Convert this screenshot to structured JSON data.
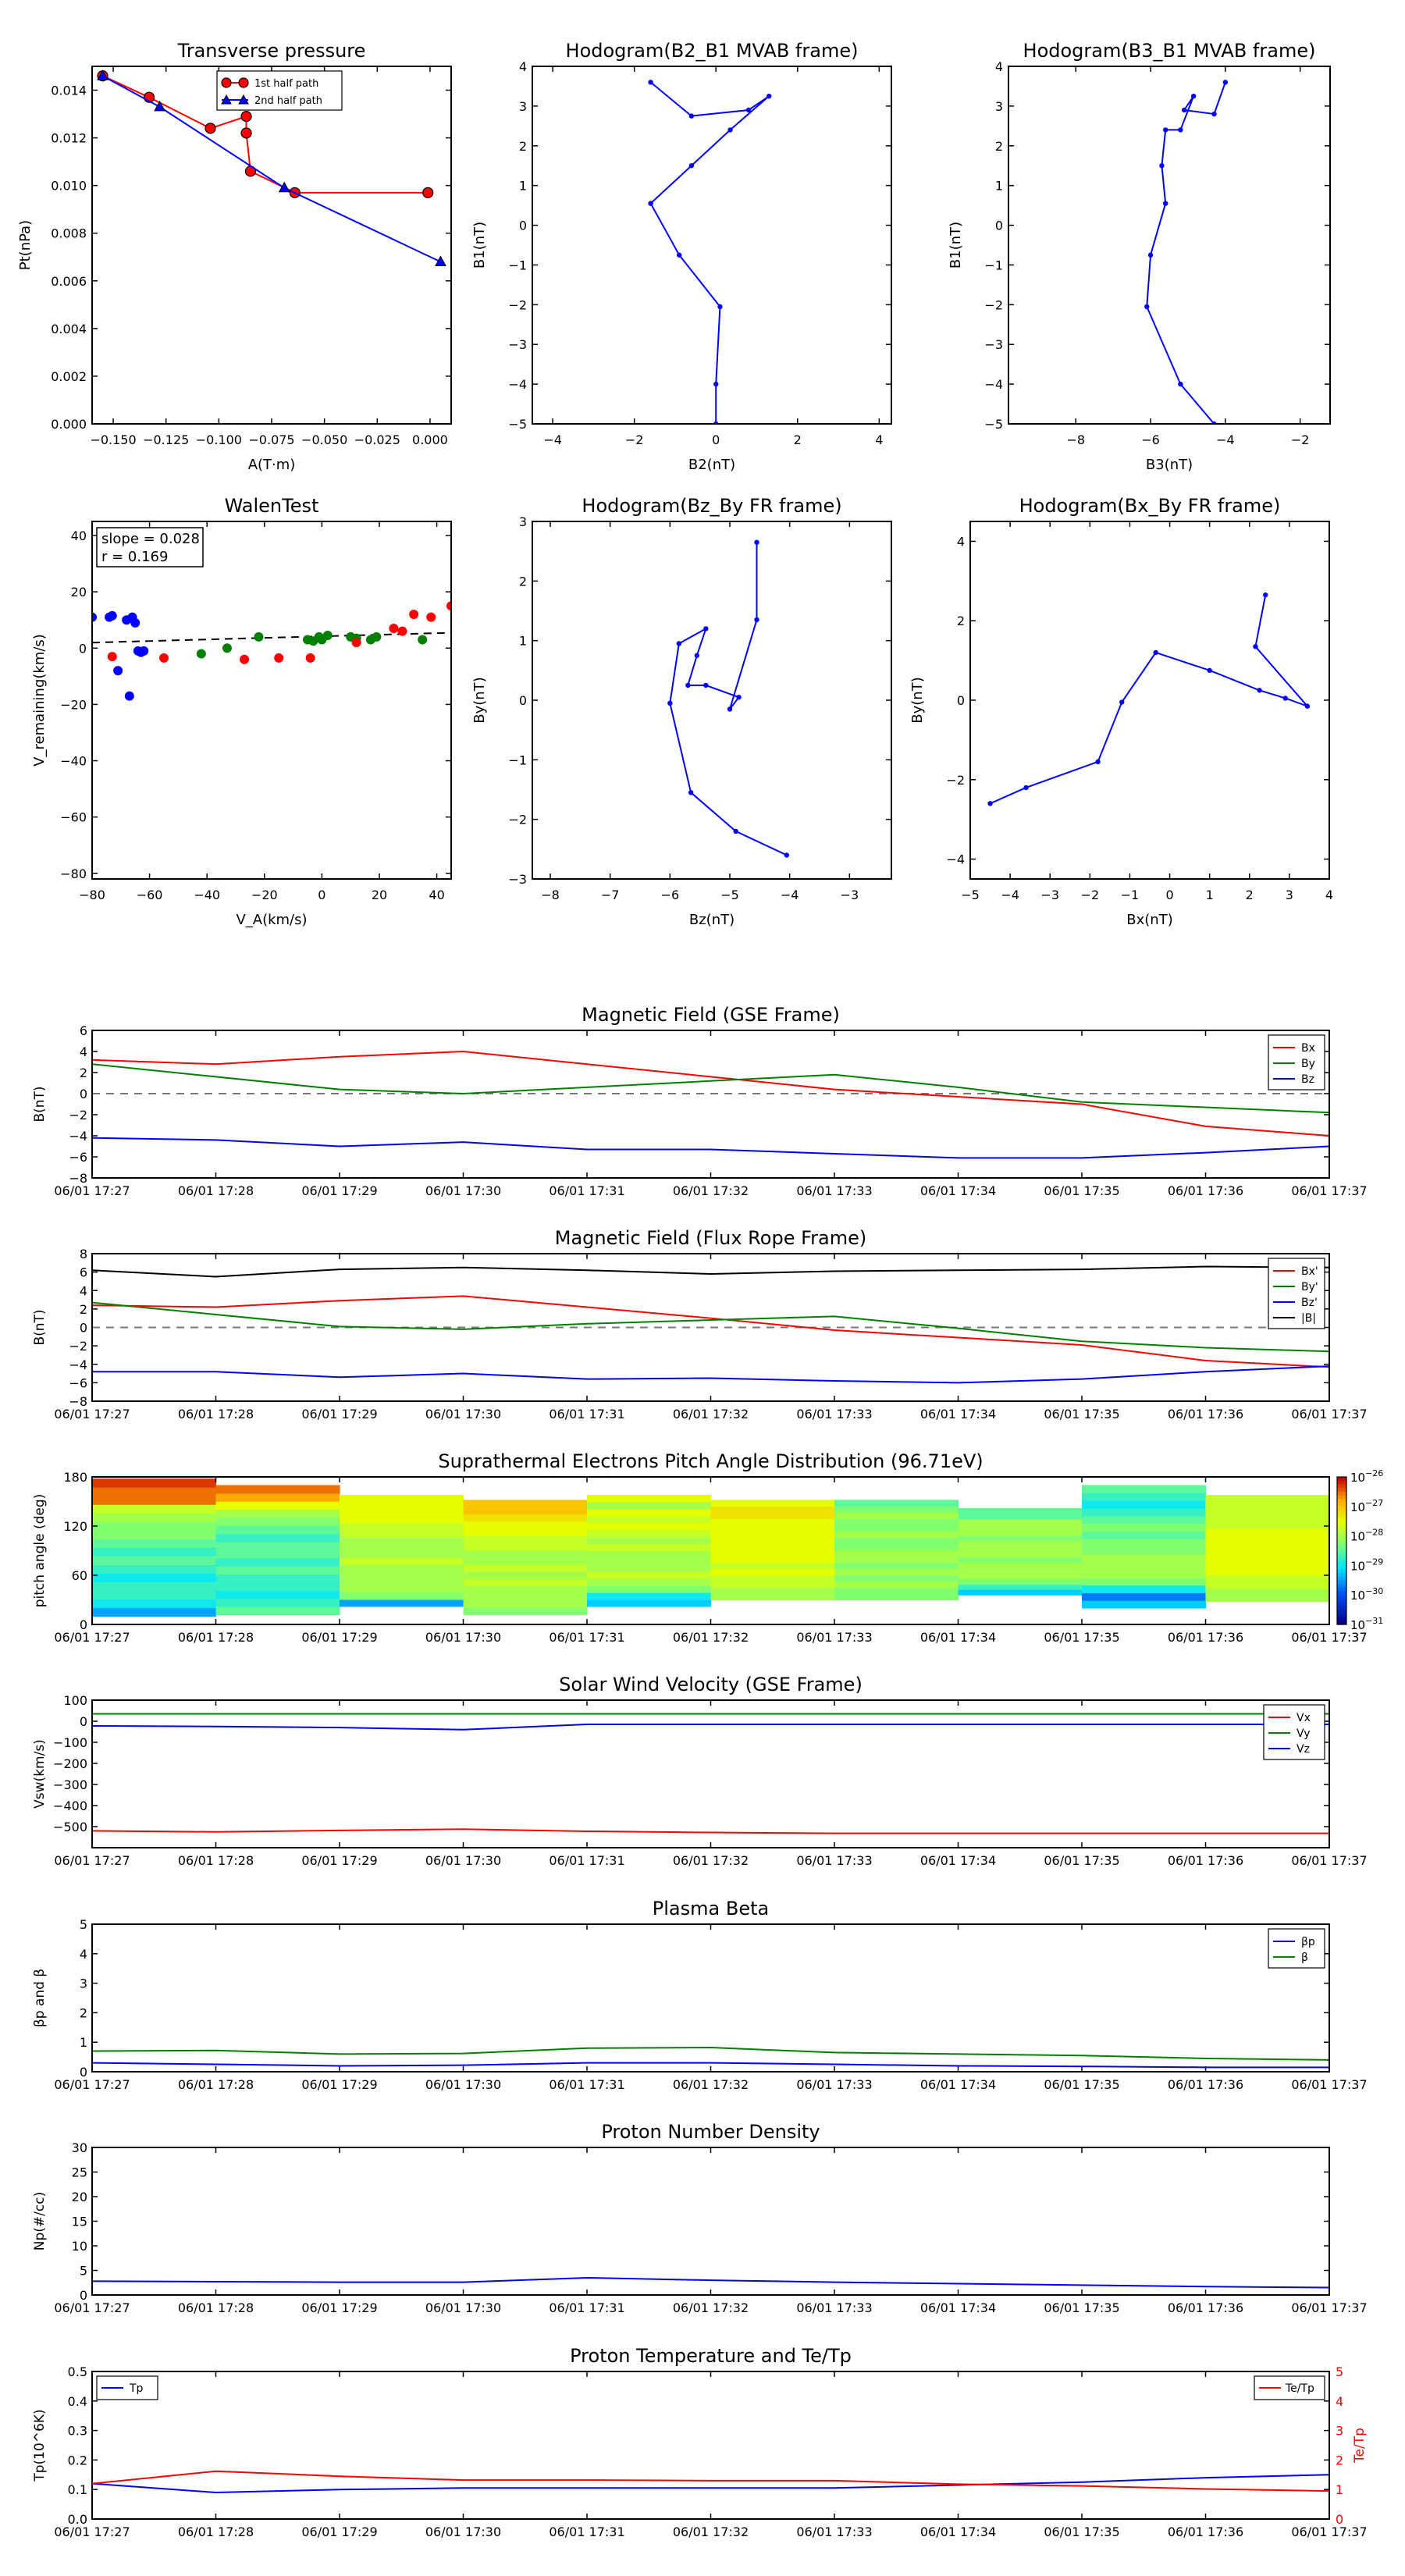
{
  "chart_data": [
    {
      "id": "tp",
      "type": "line",
      "title": "Transverse pressure",
      "xlabel": "A(T·m)",
      "ylabel": "Pt(nPa)",
      "xlim": [
        -0.16,
        0.01
      ],
      "ylim": [
        0,
        0.015
      ],
      "xticks": [
        -0.15,
        -0.125,
        -0.1,
        -0.075,
        -0.05,
        -0.025,
        0.0
      ],
      "xtick_labels": [
        "−0.150",
        "−0.125",
        "−0.100",
        "−0.075",
        "−0.050",
        "−0.025",
        "0.000"
      ],
      "yticks": [
        0,
        0.002,
        0.004,
        0.006,
        0.008,
        0.01,
        0.012,
        0.014
      ],
      "ytick_labels": [
        "0.000",
        "0.002",
        "0.004",
        "0.006",
        "0.008",
        "0.010",
        "0.012",
        "0.014"
      ],
      "legend": "upper-center",
      "series": [
        {
          "name": "1st half path",
          "color": "#ff0000",
          "marker": "circle",
          "x": [
            -0.155,
            -0.133,
            -0.104,
            -0.087,
            -0.087,
            -0.085,
            -0.064,
            -0.001
          ],
          "y": [
            0.0146,
            0.0137,
            0.0124,
            0.0129,
            0.0122,
            0.0106,
            0.0097,
            0.0097
          ]
        },
        {
          "name": "2nd half path",
          "color": "#0000ff",
          "marker": "triangle",
          "x": [
            -0.155,
            -0.128,
            -0.069,
            0.005
          ],
          "y": [
            0.0146,
            0.0133,
            0.0099,
            0.0068
          ]
        }
      ]
    },
    {
      "id": "hodo1",
      "type": "line",
      "title": "Hodogram(B2_B1 MVAB frame)",
      "xlabel": "B2(nT)",
      "ylabel": "B1(nT)",
      "xlim": [
        -4.5,
        4.3
      ],
      "ylim": [
        -5,
        4
      ],
      "xticks": [
        -4,
        -2,
        0,
        2,
        4
      ],
      "yticks": [
        -5,
        -4,
        -3,
        -2,
        -1,
        0,
        1,
        2,
        3,
        4
      ],
      "series": [
        {
          "color": "#0000ff",
          "x": [
            -1.6,
            -0.6,
            0.8,
            1.3,
            0.35,
            -0.6,
            -1.6,
            -0.9,
            0.1,
            0.0,
            0.0
          ],
          "y": [
            3.6,
            2.75,
            2.9,
            3.25,
            2.4,
            1.5,
            0.55,
            -0.75,
            -2.05,
            -4.0,
            -5.0
          ]
        }
      ]
    },
    {
      "id": "hodo2",
      "type": "line",
      "title": "Hodogram(B3_B1 MVAB frame)",
      "xlabel": "B3(nT)",
      "ylabel": "B1(nT)",
      "xlim": [
        -9.8,
        -1.2
      ],
      "ylim": [
        -5,
        4
      ],
      "xticks": [
        -8,
        -6,
        -4,
        -2
      ],
      "yticks": [
        -5,
        -4,
        -3,
        -2,
        -1,
        0,
        1,
        2,
        3,
        4
      ],
      "series": [
        {
          "color": "#0000ff",
          "x": [
            -4.0,
            -4.3,
            -5.1,
            -4.85,
            -5.2,
            -5.6,
            -5.7,
            -5.6,
            -6.0,
            -6.1,
            -5.2,
            -4.3
          ],
          "y": [
            3.6,
            2.8,
            2.9,
            3.25,
            2.4,
            2.4,
            1.5,
            0.55,
            -0.75,
            -2.05,
            -4.0,
            -5.0
          ]
        }
      ]
    },
    {
      "id": "walen",
      "type": "scatter",
      "title": "WalenTest",
      "xlabel": "V_A(km/s)",
      "ylabel": "V_remaining(km/s)",
      "xlim": [
        -80,
        45
      ],
      "ylim": [
        -82,
        45
      ],
      "xticks": [
        -80,
        -60,
        -40,
        -20,
        0,
        20,
        40
      ],
      "yticks": [
        -80,
        -60,
        -40,
        -20,
        0,
        20,
        40
      ],
      "annotation": [
        "slope = 0.028",
        "r = 0.169"
      ],
      "fit": {
        "slope": 0.028,
        "intercept": 4.2
      },
      "series": [
        {
          "color": "#0000ff",
          "x": [
            -80,
            -74,
            -73,
            -71,
            -68,
            -67,
            -66,
            -65,
            -64,
            -63,
            -62
          ],
          "y": [
            11,
            11,
            11.5,
            -8,
            10,
            -17,
            11,
            9,
            -1,
            -1.5,
            -1
          ]
        },
        {
          "color": "#008000",
          "x": [
            -42,
            -33,
            -22,
            -5,
            -3,
            -1,
            0,
            2,
            10,
            12,
            17,
            19,
            35
          ],
          "y": [
            -2,
            0,
            4,
            3,
            2.5,
            4,
            3,
            4.5,
            4,
            3.5,
            3,
            4,
            3
          ]
        },
        {
          "color": "#ff0000",
          "x": [
            -73,
            -55,
            -27,
            -15,
            -4,
            12,
            25,
            28,
            32,
            38,
            45
          ],
          "y": [
            -3,
            -3.5,
            -4,
            -3.5,
            -3.5,
            2,
            7,
            6,
            12,
            11,
            15
          ]
        }
      ]
    },
    {
      "id": "hodo3",
      "type": "line",
      "title": "Hodogram(Bz_By FR frame)",
      "xlabel": "Bz(nT)",
      "ylabel": "By(nT)",
      "xlim": [
        -8.3,
        -2.3
      ],
      "ylim": [
        -3,
        3
      ],
      "xticks": [
        -8,
        -7,
        -6,
        -5,
        -4,
        -3
      ],
      "yticks": [
        -3,
        -2,
        -1,
        0,
        1,
        2,
        3
      ],
      "series": [
        {
          "color": "#0000ff",
          "x": [
            -4.55,
            -4.55,
            -5.0,
            -4.85,
            -5.4,
            -5.7,
            -5.55,
            -5.4,
            -5.85,
            -6.0,
            -5.65,
            -4.9,
            -4.05
          ],
          "y": [
            2.65,
            1.35,
            -0.15,
            0.05,
            0.25,
            0.25,
            0.75,
            1.2,
            0.95,
            -0.05,
            -1.55,
            -2.2,
            -2.6
          ]
        }
      ]
    },
    {
      "id": "hodo4",
      "type": "line",
      "title": "Hodogram(Bx_By FR frame)",
      "xlabel": "Bx(nT)",
      "ylabel": "By(nT)",
      "xlim": [
        -5,
        4
      ],
      "ylim": [
        -4.5,
        4.5
      ],
      "xticks": [
        -5,
        -4,
        -3,
        -2,
        -1,
        0,
        1,
        2,
        3,
        4
      ],
      "yticks": [
        -4,
        -2,
        0,
        2,
        4
      ],
      "series": [
        {
          "color": "#0000ff",
          "x": [
            2.4,
            2.15,
            3.45,
            2.9,
            2.25,
            1.0,
            -0.35,
            -1.2,
            -1.8,
            -3.6,
            -4.5
          ],
          "y": [
            2.65,
            1.35,
            -0.15,
            0.05,
            0.25,
            0.75,
            1.2,
            -0.05,
            -1.55,
            -2.2,
            -2.6
          ]
        }
      ]
    },
    {
      "id": "mag_gse",
      "type": "line",
      "title": "Magnetic Field (GSE Frame)",
      "ylabel": "B(nT)",
      "ylim": [
        -8,
        6
      ],
      "yticks": [
        -8,
        -6,
        -4,
        -2,
        0,
        2,
        4,
        6
      ],
      "hline": 0,
      "legend": "top-right",
      "series": [
        {
          "name": "Bx",
          "color": "#ff0000",
          "values": [
            3.2,
            2.8,
            3.5,
            4.0,
            2.8,
            1.6,
            0.4,
            -0.3,
            -1.0,
            -3.1,
            -4.0
          ]
        },
        {
          "name": "By",
          "color": "#008000",
          "values": [
            2.8,
            1.6,
            0.4,
            0.0,
            0.6,
            1.2,
            1.8,
            0.6,
            -0.8,
            -1.3,
            -1.8
          ]
        },
        {
          "name": "Bz",
          "color": "#0000ff",
          "values": [
            -4.2,
            -4.4,
            -5.0,
            -4.6,
            -5.3,
            -5.3,
            -5.7,
            -6.1,
            -6.1,
            -5.6,
            -5.0
          ]
        }
      ]
    },
    {
      "id": "mag_fr",
      "type": "line",
      "title": "Magnetic Field (Flux Rope Frame)",
      "ylabel": "B(nT)",
      "ylim": [
        -8,
        8
      ],
      "yticks": [
        -8,
        -6,
        -4,
        -2,
        0,
        2,
        4,
        6,
        8
      ],
      "hline": 0,
      "legend": "top-right",
      "series": [
        {
          "name": "Bx'",
          "color": "#ff0000",
          "values": [
            2.4,
            2.2,
            2.9,
            3.4,
            2.2,
            1.0,
            -0.3,
            -1.1,
            -1.9,
            -3.6,
            -4.3
          ]
        },
        {
          "name": "By'",
          "color": "#008000",
          "values": [
            2.7,
            1.4,
            0.1,
            -0.2,
            0.4,
            0.8,
            1.2,
            -0.1,
            -1.5,
            -2.2,
            -2.6
          ]
        },
        {
          "name": "Bz'",
          "color": "#0000ff",
          "values": [
            -4.8,
            -4.8,
            -5.4,
            -5.0,
            -5.6,
            -5.5,
            -5.8,
            -6.0,
            -5.6,
            -4.8,
            -4.2
          ]
        },
        {
          "name": "|B|",
          "color": "#000000",
          "values": [
            6.2,
            5.5,
            6.3,
            6.5,
            6.2,
            5.8,
            6.1,
            6.2,
            6.3,
            6.6,
            6.5
          ]
        }
      ]
    },
    {
      "id": "pad",
      "type": "heatmap",
      "title": "Suprathermal Electrons Pitch Angle Distribution (96.71eV)",
      "ylabel": "pitch angle (deg)",
      "ylim": [
        0,
        180
      ],
      "yticks": [
        0,
        60,
        120,
        180
      ],
      "colorbar": {
        "labels": [
          "10^-26",
          "10^-27",
          "10^-28",
          "10^-29",
          "10^-30",
          "10^-31"
        ]
      },
      "columns": [
        {
          "lo": 10,
          "hi": 178,
          "rows": [
            0.3,
            0.4,
            0.45,
            0.45,
            0.4,
            0.45,
            0.5,
            0.45,
            0.5,
            0.55,
            0.55,
            0.6,
            0.65,
            0.9,
            0.9,
            0.95
          ]
        },
        {
          "lo": 12,
          "hi": 170,
          "rows": [
            0.5,
            0.45,
            0.4,
            0.45,
            0.45,
            0.5,
            0.45,
            0.5,
            0.5,
            0.45,
            0.5,
            0.55,
            0.6,
            0.7,
            0.85,
            0.9
          ]
        },
        {
          "lo": 22,
          "hi": 158,
          "rows": [
            0.3,
            0.55,
            0.6,
            0.6,
            0.6,
            0.6,
            0.65,
            0.6,
            0.6,
            0.6,
            0.65,
            0.65,
            0.7,
            0.7,
            0.7,
            0.7
          ]
        },
        {
          "lo": 12,
          "hi": 152,
          "rows": [
            0.55,
            0.6,
            0.6,
            0.6,
            0.65,
            0.6,
            0.65,
            0.6,
            0.6,
            0.65,
            0.65,
            0.7,
            0.7,
            0.75,
            0.8,
            0.8
          ]
        },
        {
          "lo": 22,
          "hi": 158,
          "rows": [
            0.35,
            0.4,
            0.55,
            0.6,
            0.65,
            0.6,
            0.6,
            0.6,
            0.65,
            0.6,
            0.65,
            0.7,
            0.65,
            0.7,
            0.6,
            0.7
          ]
        },
        {
          "lo": 30,
          "hi": 152,
          "rows": [
            0.6,
            0.6,
            0.65,
            0.65,
            0.7,
            0.65,
            0.7,
            0.7,
            0.7,
            0.7,
            0.7,
            0.7,
            0.7,
            0.75,
            0.75,
            0.7
          ]
        },
        {
          "lo": 30,
          "hi": 152,
          "rows": [
            0.55,
            0.55,
            0.6,
            0.55,
            0.6,
            0.55,
            0.6,
            0.6,
            0.55,
            0.55,
            0.6,
            0.55,
            0.55,
            0.6,
            0.55,
            0.5
          ]
        },
        {
          "lo": 36,
          "hi": 142,
          "rows": [
            0.35,
            0.45,
            0.55,
            0.6,
            0.6,
            0.6,
            0.55,
            0.6,
            0.6,
            0.6,
            0.55,
            0.6,
            0.6,
            0.6,
            0.5,
            0.5
          ]
        },
        {
          "lo": 20,
          "hi": 170,
          "rows": [
            0.35,
            0.25,
            0.4,
            0.55,
            0.6,
            0.6,
            0.6,
            0.55,
            0.55,
            0.5,
            0.55,
            0.5,
            0.45,
            0.4,
            0.45,
            0.5
          ]
        },
        {
          "lo": 28,
          "hi": 158,
          "rows": [
            0.6,
            0.6,
            0.65,
            0.65,
            0.7,
            0.7,
            0.7,
            0.7,
            0.7,
            0.7,
            0.7,
            0.65,
            0.65,
            0.65,
            0.65,
            0.65
          ]
        }
      ]
    },
    {
      "id": "vsw",
      "type": "line",
      "title": "Solar Wind Velocity (GSE Frame)",
      "ylabel": "Vsw(km/s)",
      "ylim": [
        -600,
        100
      ],
      "yticks": [
        -600,
        -500,
        -400,
        -300,
        -200,
        -100,
        0,
        100
      ],
      "yticks_skip_labels": [
        -600
      ],
      "legend": "top-right",
      "series": [
        {
          "name": "Vx",
          "color": "#ff0000",
          "values": [
            -520,
            -525,
            -518,
            -512,
            -522,
            -528,
            -532,
            -532,
            -532,
            -532,
            -532
          ]
        },
        {
          "name": "Vy",
          "color": "#008000",
          "values": [
            35,
            35,
            35,
            35,
            35,
            35,
            35,
            35,
            35,
            35,
            35
          ]
        },
        {
          "name": "Vz",
          "color": "#0000ff",
          "values": [
            -22,
            -25,
            -30,
            -40,
            -15,
            -15,
            -15,
            -15,
            -15,
            -15,
            -15
          ]
        }
      ]
    },
    {
      "id": "beta",
      "type": "line",
      "title": "Plasma Beta",
      "ylabel": "βp and β",
      "ylim": [
        0,
        5
      ],
      "yticks": [
        0,
        1,
        2,
        3,
        4,
        5
      ],
      "legend": "top-right",
      "series": [
        {
          "name": "βp",
          "color": "#0000ff",
          "values": [
            0.3,
            0.25,
            0.2,
            0.22,
            0.3,
            0.3,
            0.25,
            0.2,
            0.18,
            0.15,
            0.15
          ]
        },
        {
          "name": "β",
          "color": "#008000",
          "values": [
            0.7,
            0.72,
            0.6,
            0.62,
            0.8,
            0.82,
            0.65,
            0.6,
            0.55,
            0.45,
            0.4
          ]
        }
      ]
    },
    {
      "id": "np",
      "type": "line",
      "title": "Proton Number Density",
      "ylabel": "Np(#/cc)",
      "ylim": [
        0,
        30
      ],
      "yticks": [
        0,
        5,
        10,
        15,
        20,
        25,
        30
      ],
      "series": [
        {
          "color": "#0000ff",
          "values": [
            2.8,
            2.7,
            2.6,
            2.6,
            3.5,
            3.0,
            2.6,
            2.3,
            2.0,
            1.7,
            1.5
          ]
        }
      ]
    },
    {
      "id": "temp",
      "type": "line",
      "title": "Proton Temperature and Te/Tp",
      "ylabel": "Tp(10^6K)",
      "ylabel_right": "Te/Tp",
      "ylim": [
        0,
        0.5
      ],
      "yticks": [
        0,
        0.1,
        0.2,
        0.3,
        0.4,
        0.5
      ],
      "ylim_right": [
        0,
        5
      ],
      "yticks_right": [
        0,
        1,
        2,
        3,
        4,
        5
      ],
      "series": [
        {
          "name": "Tp",
          "color": "#0000ff",
          "axis": "left",
          "values": [
            0.12,
            0.09,
            0.1,
            0.105,
            0.105,
            0.105,
            0.105,
            0.115,
            0.125,
            0.14,
            0.15
          ]
        },
        {
          "name": "Te/Tp",
          "color": "#ff0000",
          "axis": "right",
          "values": [
            1.2,
            1.62,
            1.45,
            1.32,
            1.32,
            1.3,
            1.3,
            1.18,
            1.12,
            1.02,
            0.95
          ]
        }
      ]
    }
  ],
  "time_axis": {
    "labels": [
      "06/01 17:27",
      "06/01 17:28",
      "06/01 17:29",
      "06/01 17:30",
      "06/01 17:31",
      "06/01 17:32",
      "06/01 17:33",
      "06/01 17:34",
      "06/01 17:35",
      "06/01 17:36",
      "06/01 17:37"
    ]
  }
}
